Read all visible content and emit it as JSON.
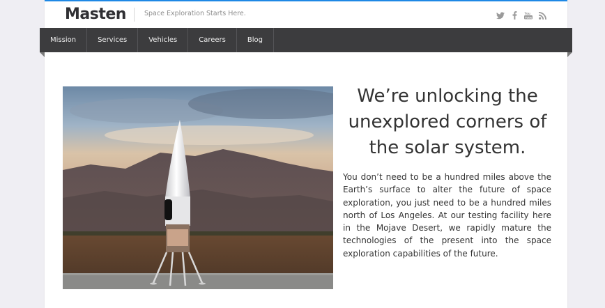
{
  "header": {
    "logo_text": "Masten",
    "tagline": "Space Exploration Starts Here.",
    "social_icons": [
      "twitter-icon",
      "facebook-icon",
      "youtube-icon",
      "rss-icon"
    ],
    "accent_color": "#1e88e5"
  },
  "nav": {
    "items": [
      {
        "label": "Mission"
      },
      {
        "label": "Services"
      },
      {
        "label": "Vehicles"
      },
      {
        "label": "Careers"
      },
      {
        "label": "Blog"
      }
    ]
  },
  "hero": {
    "image": "rocket-lander-desert-photo",
    "headline": "We’re unlocking the unexplored corners of the solar system.",
    "body": "You don’t need to be a hundred miles above the Earth’s surface to alter the future of space exploration, you just need to be a hundred miles north of Los Angeles. At our testing facility here in the Mojave Desert, we rapidly mature the technologies of the present into the space exploration capabilities of the future."
  }
}
